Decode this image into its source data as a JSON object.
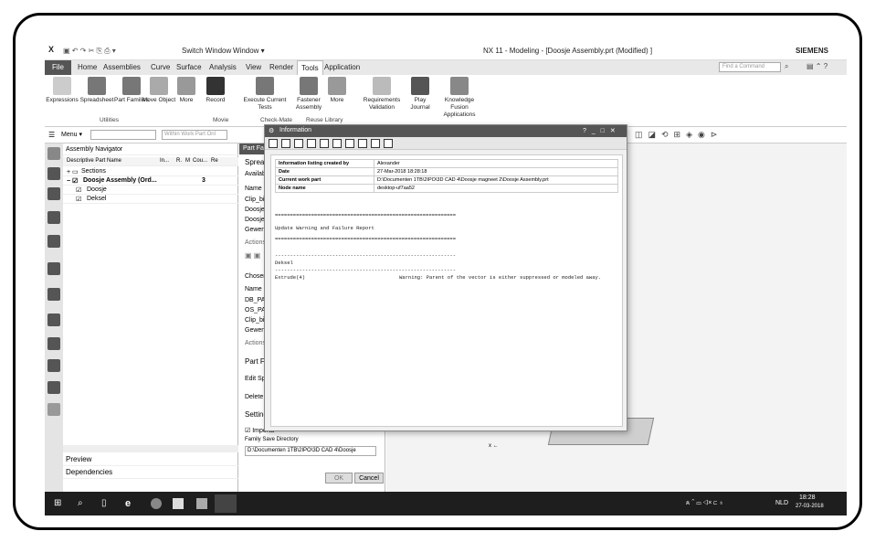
{
  "window": {
    "title": "NX 11 - Modeling - [Doosje Assembly.prt (Modified) ]",
    "brand": "SIEMENS",
    "switch_window": "Switch Window",
    "window_menu": "Window ▾"
  },
  "menubar": {
    "items": [
      "File",
      "Home",
      "Assemblies",
      "Curve",
      "Surface",
      "Analysis",
      "View",
      "Render",
      "Tools",
      "Application"
    ],
    "search_placeholder": "Find a Command"
  },
  "ribbon": {
    "buttons": [
      "Expressions",
      "Spreadsheet",
      "Part Families",
      "Move Object",
      "More",
      "Record",
      "Execute Current Tests",
      "Fastener Assembly",
      "More",
      "Requirements Validation",
      "Play Journal",
      "Knowledge Fusion Applications"
    ],
    "groups": [
      "Utilities",
      "Movie",
      "Check-Mate",
      "Reuse Library"
    ]
  },
  "cmdbar": {
    "menu_label": "Menu ▾",
    "filter": "Within Work Part Onl"
  },
  "navigator": {
    "title": "Assembly Navigator",
    "columns": [
      "Descriptive Part Name",
      "In...",
      "R.",
      "M",
      "Cou...",
      "Re"
    ],
    "rows": [
      {
        "name": "Sections",
        "count": ""
      },
      {
        "name": "Doosje Assembly (Ord...",
        "count": "3"
      },
      {
        "name": "Doosje",
        "count": ""
      },
      {
        "name": "Deksel",
        "count": ""
      }
    ],
    "preview": "Preview",
    "dependencies": "Dependencies"
  },
  "partfamily": {
    "tab": "Part Fam",
    "spreadsheet": "Spreadshe",
    "available": "Available C",
    "name_col": "Name",
    "available_items": [
      "Clip_binne",
      "Doosje_ba",
      "Doosje_dri",
      "Gewenste_"
    ],
    "actions": "Actions",
    "chosen": "Chosen Col",
    "chosen_name": "Name",
    "chosen_items": [
      "DB_PART_N",
      "OS_PART_N",
      "Clip_binne",
      "Gewenste_"
    ],
    "actions2": "Actions",
    "part_family": "Part Famil",
    "edit_spread": "Edit Spread",
    "delete_fam": "Delete Fam",
    "settings": "Settings",
    "import": "Importa",
    "family_dir_label": "Family Save Directory",
    "family_dir": "D:\\Documenten 1TB\\2IPO\\3D CAD 4\\Doosje",
    "ok": "OK",
    "cancel": "Cancel"
  },
  "dialog": {
    "title": "Information",
    "controls": "? _ □ ✕",
    "info": [
      {
        "k": "Information listing created by",
        "v": "Alexander"
      },
      {
        "k": "Date",
        "v": "27-Mar-2018 18:28:18"
      },
      {
        "k": "Current work part",
        "v": "D:\\Documenten 1TB\\2IPO\\3D CAD 4\\Doosje magneet 2\\Doosje Assembly.prt"
      },
      {
        "k": "Node name",
        "v": "desktop-uf7aa52"
      }
    ],
    "stars": "============================================================",
    "report_title": "Update Warning and Failure Report",
    "dash": "------------------------------------------------------------",
    "part": "Deksel",
    "feature": "Extrude(4)",
    "warning": "Warning: Parent of the vector is either suppressed or modeled away."
  },
  "taskbar": {
    "lang": "NLD",
    "time": "18:28",
    "date": "27-03-2018"
  }
}
